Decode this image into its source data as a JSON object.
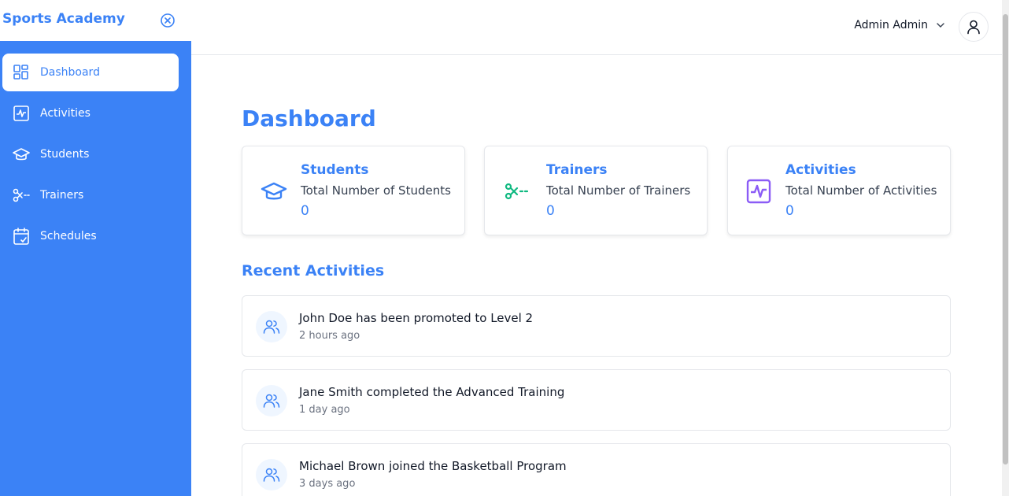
{
  "brand": "Sports Academy",
  "sidebar": {
    "items": [
      {
        "label": "Dashboard",
        "icon": "dashboard-icon",
        "active": true
      },
      {
        "label": "Activities",
        "icon": "activity-icon"
      },
      {
        "label": "Students",
        "icon": "graduation-cap-icon"
      },
      {
        "label": "Trainers",
        "icon": "scissors-icon"
      },
      {
        "label": "Schedules",
        "icon": "calendar-check-icon"
      }
    ]
  },
  "header": {
    "user_name": "Admin Admin"
  },
  "page_title": "Dashboard",
  "cards": [
    {
      "title": "Students",
      "subtitle": "Total Number of Students",
      "value": "0",
      "icon": "graduation-cap-icon",
      "color": "#3b82f6"
    },
    {
      "title": "Trainers",
      "subtitle": "Total Number of Trainers",
      "value": "0",
      "icon": "scissors-icon",
      "color": "#10b981"
    },
    {
      "title": "Activities",
      "subtitle": "Total Number of Activities",
      "value": "0",
      "icon": "activity-icon",
      "color": "#8b5cf6"
    }
  ],
  "recent": {
    "title": "Recent Activities",
    "items": [
      {
        "text": "John Doe has been promoted to Level 2",
        "time": "2 hours ago"
      },
      {
        "text": "Jane Smith completed the Advanced Training",
        "time": "1 day ago"
      },
      {
        "text": "Michael Brown joined the Basketball Program",
        "time": "3 days ago"
      }
    ]
  },
  "colors": {
    "accent": "#3b82f6",
    "trainers": "#10b981",
    "activities": "#8b5cf6"
  }
}
